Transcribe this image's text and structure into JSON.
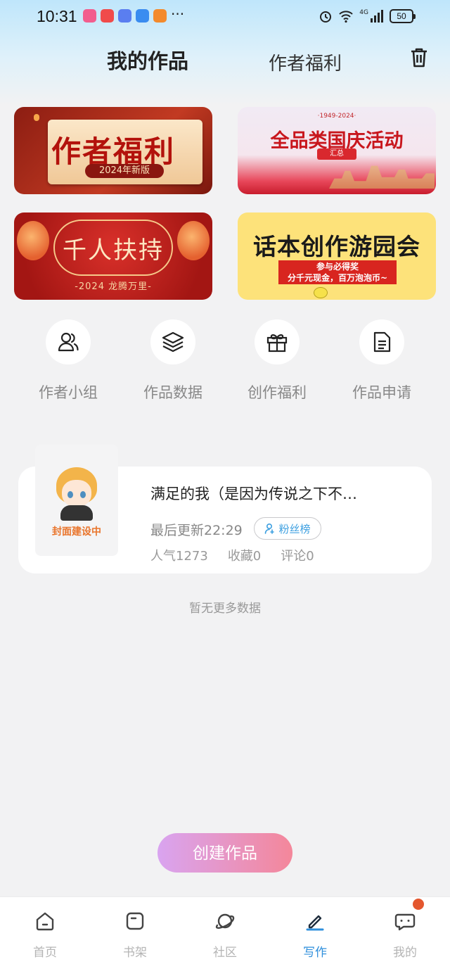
{
  "status_bar": {
    "time": "10:31",
    "more": "···",
    "battery": "50",
    "network": "4G"
  },
  "header": {
    "tab_mine": "我的作品",
    "tab_welfare": "作者福利",
    "trash_icon": "trash-icon"
  },
  "banners": [
    {
      "title": "作者福利",
      "subtitle": "2024年新版"
    },
    {
      "top": "·1949-2024·",
      "title": "全品类国庆活动",
      "subtitle": "汇总"
    },
    {
      "title": "千人扶持",
      "subtitle": "-2024 龙腾万里-"
    },
    {
      "title": "话本创作游园会",
      "subtitle_1": "参与必得奖",
      "subtitle_2": "分千元现金，百万泡泡币~"
    }
  ],
  "quick_actions": [
    {
      "label": "作者小组",
      "icon": "users-icon"
    },
    {
      "label": "作品数据",
      "icon": "layers-icon"
    },
    {
      "label": "创作福利",
      "icon": "gift-icon"
    },
    {
      "label": "作品申请",
      "icon": "document-icon"
    }
  ],
  "work": {
    "cover_text": "封面建设中",
    "title": "满足的我（是因为传说之下不…",
    "updated": "最后更新22:29",
    "fans_badge": "粉丝榜",
    "popularity": "人气1273",
    "favorites": "收藏0",
    "comments": "评论0"
  },
  "no_more": "暂无更多数据",
  "create_button": "创建作品",
  "bottom_nav": [
    {
      "label": "首页",
      "icon": "home-icon"
    },
    {
      "label": "书架",
      "icon": "bookshelf-icon"
    },
    {
      "label": "社区",
      "icon": "planet-icon"
    },
    {
      "label": "写作",
      "icon": "pen-icon",
      "active": true
    },
    {
      "label": "我的",
      "icon": "message-icon"
    }
  ],
  "colors": {
    "accent": "#2f8fdc",
    "badge_dot": "#e4572e",
    "button_start": "#d9a4f0",
    "button_end": "#f4879a"
  }
}
